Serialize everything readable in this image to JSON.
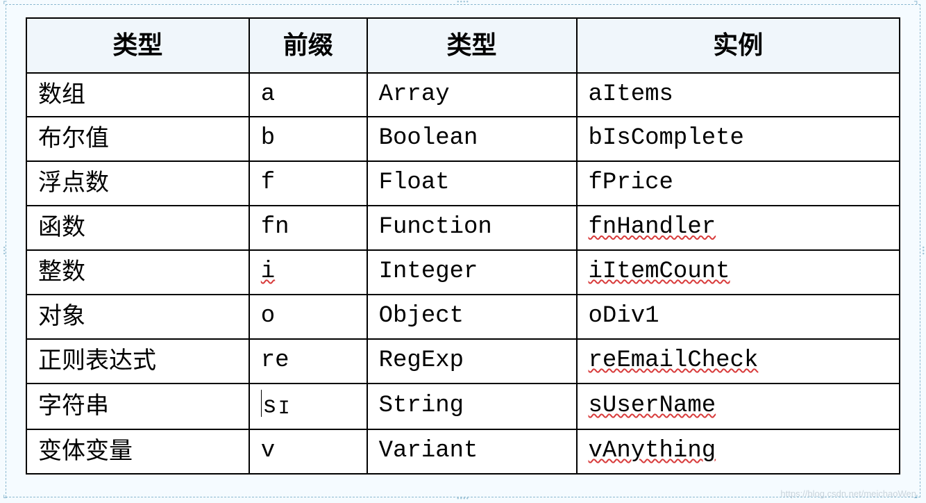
{
  "table": {
    "headers": [
      "类型",
      "前缀",
      "类型",
      "实例"
    ],
    "rows": [
      {
        "typeCn": "数组",
        "prefix": "a",
        "typeEn": "Array",
        "example": "aItems",
        "prefixSquiggle": false,
        "exampleSquiggle": false
      },
      {
        "typeCn": "布尔值",
        "prefix": "b",
        "typeEn": "Boolean",
        "example": "bIsComplete",
        "prefixSquiggle": false,
        "exampleSquiggle": false
      },
      {
        "typeCn": "浮点数",
        "prefix": "f",
        "typeEn": "Float",
        "example": "fPrice",
        "prefixSquiggle": false,
        "exampleSquiggle": false
      },
      {
        "typeCn": "函数",
        "prefix": "fn",
        "typeEn": "Function",
        "example": "fnHandler",
        "prefixSquiggle": false,
        "exampleSquiggle": true
      },
      {
        "typeCn": "整数",
        "prefix": "i",
        "typeEn": "Integer",
        "example": "iItemCount",
        "prefixSquiggle": true,
        "exampleSquiggle": true
      },
      {
        "typeCn": "对象",
        "prefix": "o",
        "typeEn": "Object",
        "example": "oDiv1",
        "prefixSquiggle": false,
        "exampleSquiggle": false
      },
      {
        "typeCn": "正则表达式",
        "prefix": "re",
        "typeEn": "RegExp",
        "example": "reEmailCheck",
        "prefixSquiggle": false,
        "exampleSquiggle": true
      },
      {
        "typeCn": "字符串",
        "prefix": "s",
        "typeEn": "String",
        "example": "sUserName",
        "prefixSquiggle": false,
        "exampleSquiggle": true,
        "hasCursor": true
      },
      {
        "typeCn": "变体变量",
        "prefix": "v",
        "typeEn": "Variant",
        "example": "vAnything",
        "prefixSquiggle": false,
        "exampleSquiggle": true
      }
    ]
  },
  "watermark": "https://blog.csdn.net/meichaoWen"
}
